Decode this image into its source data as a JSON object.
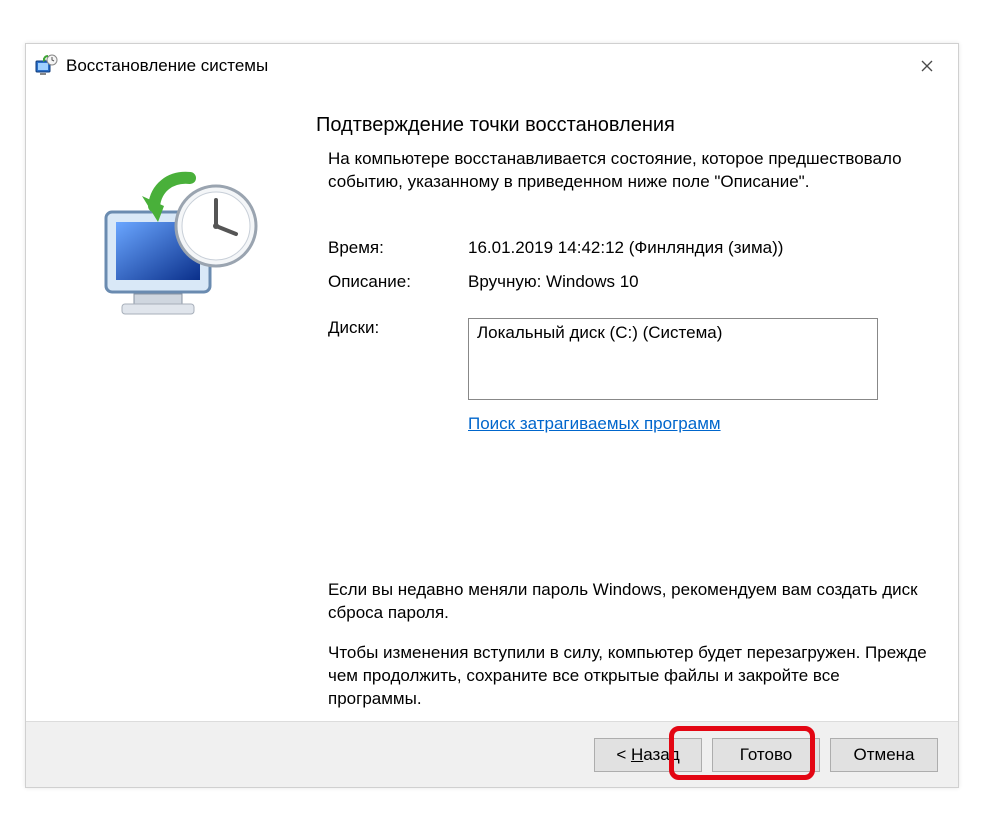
{
  "window": {
    "title": "Восстановление системы"
  },
  "main": {
    "heading": "Подтверждение точки восстановления",
    "intro": "На компьютере восстанавливается состояние, которое предшествовало событию, указанному в приведенном ниже поле \"Описание\".",
    "time_label": "Время:",
    "time_value": "16.01.2019 14:42:12 (Финляндия (зима))",
    "desc_label": "Описание:",
    "desc_value": "Вручную: Windows 10",
    "disks_label": "Диски:",
    "disks_value": "Локальный диск (C:) (Система)",
    "scan_link": "Поиск затрагиваемых программ",
    "warn1": "Если вы недавно меняли пароль Windows, рекомендуем вам создать диск сброса пароля.",
    "warn2": "Чтобы изменения вступили в силу, компьютер будет перезагружен. Прежде чем продолжить, сохраните все открытые файлы и закройте все программы."
  },
  "buttons": {
    "back_prefix": "< ",
    "back_u": "Н",
    "back_rest": "азад",
    "finish": "Готово",
    "cancel": "Отмена"
  }
}
